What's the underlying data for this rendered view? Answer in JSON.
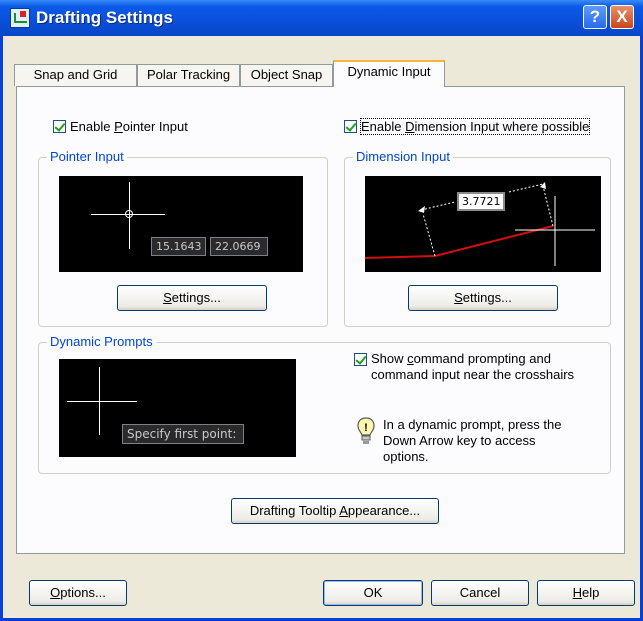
{
  "window": {
    "title": "Drafting Settings",
    "help_button": "?",
    "close_button": "X"
  },
  "tabs": [
    {
      "label": "Snap and Grid"
    },
    {
      "label": "Polar Tracking"
    },
    {
      "label": "Object Snap"
    },
    {
      "label": "Dynamic Input"
    }
  ],
  "active_tab": "Dynamic Input",
  "enable_pointer_input": {
    "label_pre": "Enable ",
    "label_key": "P",
    "label_post": "ointer Input",
    "checked": true
  },
  "enable_dimension_input": {
    "label_pre": "Enable ",
    "label_key": "D",
    "label_post": "imension Input where possible",
    "checked": true
  },
  "pointer_input": {
    "title": "Pointer Input",
    "field_x": "15.1643",
    "field_y": "22.0669",
    "settings_pre": "",
    "settings_key": "S",
    "settings_post": "ettings..."
  },
  "dimension_input": {
    "title": "Dimension Input",
    "value": "3.7721",
    "settings_pre": "",
    "settings_key": "S",
    "settings_post": "ettings..."
  },
  "dynamic_prompts": {
    "title": "Dynamic Prompts",
    "preview_prompt": "Specify first point:",
    "show_prompting_line1_pre": "Show ",
    "show_prompting_line1_key": "c",
    "show_prompting_line1_post": "ommand prompting and",
    "show_prompting_line2": "command input near the crosshairs",
    "show_prompting_checked": true,
    "hint_line1": "In a dynamic prompt, press the",
    "hint_line2": "Down Arrow key to access",
    "hint_line3": "options."
  },
  "tooltip_button": {
    "pre": "Drafting Tooltip ",
    "key": "A",
    "post": "ppearance..."
  },
  "footer": {
    "options_pre": "",
    "options_key": "O",
    "options_post": "ptions...",
    "ok": "OK",
    "cancel": "Cancel",
    "help_pre": "",
    "help_key": "H",
    "help_post": "elp"
  },
  "colors": {
    "title_bar": "#0a4fd9",
    "group_title": "#0046d5",
    "active_tab_accent": "#f5b63c",
    "check_mark": "#21a121",
    "preview_bg": "#000000",
    "dimension_line": "#d01010"
  },
  "icons": {
    "hint": "lightbulb-icon",
    "app": "drafting-app-icon"
  }
}
